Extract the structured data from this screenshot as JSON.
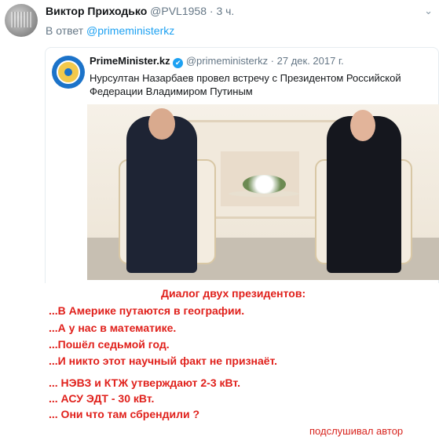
{
  "tweet": {
    "author_name": "Виктор Приходько",
    "author_handle": "@PVL1958",
    "time": "· 3 ч.",
    "reply_prefix": "В ответ",
    "reply_to": "@primeministerkz"
  },
  "quoted": {
    "name": "PrimeMinister.kz",
    "verified_icon": "✔",
    "handle_date": "@primeministerkz · 27 дек. 2017 г.",
    "text": "Нурсултан Назарбаев провел встречу с Президентом Российской Федерации Владимиром Путиным"
  },
  "caption": {
    "title": "Диалог двух президентов:",
    "lines": [
      "...В Америке путаются в географии.",
      "...А у нас в математике.",
      "...Пошёл седьмой год.",
      "...И никто этот научный факт не признаёт."
    ],
    "extra": [
      "... НЭВЗ и КТЖ утверждают 2-3 кВт.",
      "... АСУ ЭДТ - 30 кВт.",
      "... Они что там сбрендили ?"
    ],
    "signature": "подслушивал автор"
  },
  "icons": {
    "chevron": "chevron-down-icon",
    "verified": "verified-badge-icon"
  },
  "colors": {
    "accent": "#1da1f2",
    "caption_red": "#e0201b"
  }
}
